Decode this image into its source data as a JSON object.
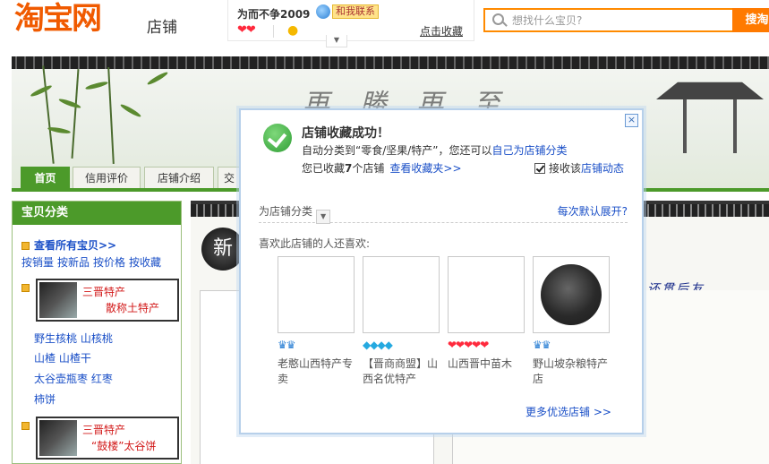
{
  "header": {
    "logo": "淘宝网",
    "logo_sub": "店铺",
    "shop_name": "为而不争2009",
    "contact": "和我联系",
    "hearts": "❤❤",
    "favorite_link": "点击收藏",
    "dropdown_glyph": "▼",
    "search_placeholder": "想找什么宝贝?",
    "search_button": "搜淘"
  },
  "banner": {
    "calligraphy": "再 勝 再 至"
  },
  "nav": {
    "tabs": [
      {
        "label": "首页"
      },
      {
        "label": "信用评价"
      },
      {
        "label": "店铺介绍"
      },
      {
        "label": "交"
      }
    ]
  },
  "sidebar": {
    "title": "宝贝分类",
    "all_items": "查看所有宝贝>>",
    "sort_links": [
      "按销量",
      "按新品",
      "按价格",
      "按收藏"
    ],
    "categories": [
      {
        "line1": "三晋特产",
        "line2": "散称土特产",
        "links": [
          "野生核桃 山核桃",
          "山楂 山楂干",
          "太谷壶瓶枣 红枣",
          "柿饼"
        ]
      },
      {
        "line1": "三晋特产",
        "line2": "“鼓楼”太谷饼",
        "links": []
      }
    ]
  },
  "main": {
    "circle_char": "新",
    "slogan": "还贯后友"
  },
  "modal": {
    "close": "×",
    "title": "店铺收藏成功！",
    "auto_text": "自动分类到“零食/坚果/特产”，您还可以",
    "auto_link": "自己为店铺分类",
    "count_prefix": "您已收藏",
    "count": "7",
    "count_suffix": "个店铺",
    "view_link": "查看收藏夹>>",
    "subscribe_prefix": "接收该",
    "subscribe_link": "店铺动态",
    "classify_label": "为店铺分类",
    "dropdown_glyph": "▼",
    "expand_link": "每次默认展开?",
    "like_label": "喜欢此店铺的人还喜欢:",
    "shops": [
      {
        "name": "老憨山西特产专卖",
        "credit": "♛♛",
        "credit_type": "crown",
        "photo": false
      },
      {
        "name": "【晋商商盟】山西名优特产",
        "credit": "◆◆◆◆",
        "credit_type": "diamond",
        "photo": false
      },
      {
        "name": "山西晋中苗木",
        "credit": "❤❤❤❤❤",
        "credit_type": "heart",
        "photo": false
      },
      {
        "name": "野山坡杂粮特产店",
        "credit": "♛♛",
        "credit_type": "crown",
        "photo": true
      }
    ],
    "more_link": "更多优选店铺 >>"
  }
}
